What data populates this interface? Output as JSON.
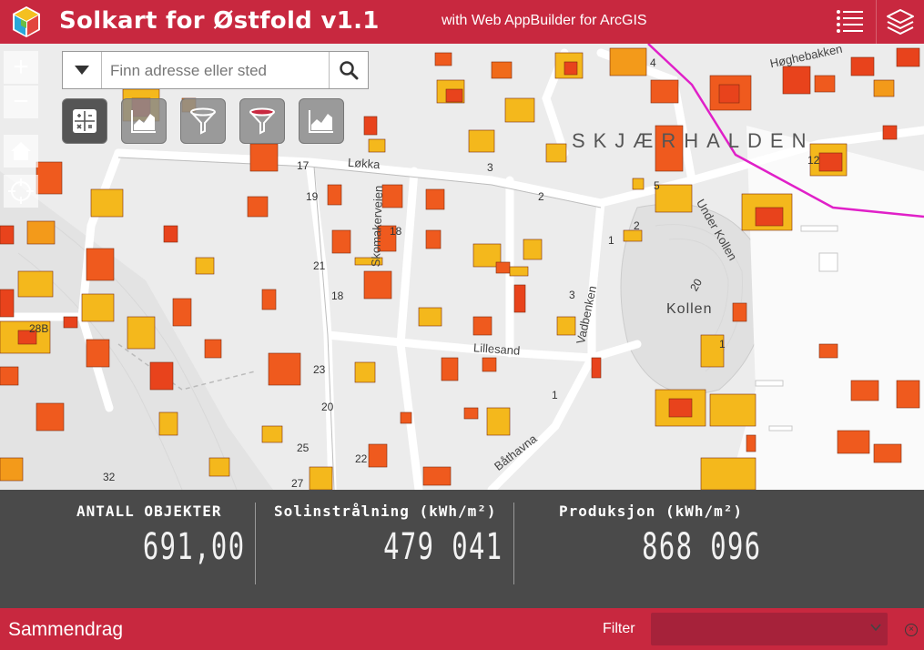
{
  "header": {
    "title": "Solkart for Østfold v1.1",
    "subtitle": "with Web AppBuilder for ArcGIS"
  },
  "search": {
    "placeholder": "Finn adresse eller sted"
  },
  "map": {
    "labels": {
      "skjaerhalden": "SKJÆRHALDEN",
      "kollen": "Kollen",
      "lokka": "Løkka",
      "skomakerveien": "Skomakerveien",
      "lillesand": "Lillesand",
      "vadbenken": "Vadbenken",
      "under_kollen": "Under Kollen",
      "bathavna": "Båthavna",
      "hoghebakken": "Høghebakken"
    },
    "house_numbers": [
      "17",
      "19",
      "21",
      "18",
      "23",
      "20",
      "25",
      "22",
      "27",
      "32",
      "2",
      "1",
      "3",
      "5",
      "2",
      "1",
      "3",
      "12",
      "4",
      "18",
      "1",
      "28B",
      "20"
    ]
  },
  "stats": {
    "count_label": "ANTALL OBJEKTER",
    "count_value": "691,00",
    "radiation_label": "Solinstrålning (kWh/m²)",
    "radiation_value": "479 041",
    "production_label": "Produksjon (kWh/m²)",
    "production_value": "868 096"
  },
  "footer": {
    "title": "Sammendrag",
    "filter_label": "Filter",
    "filter_value": ""
  },
  "colors": {
    "brand": "#c8283f",
    "stats_bg": "#4a4a4a",
    "route": "#e020c8"
  }
}
